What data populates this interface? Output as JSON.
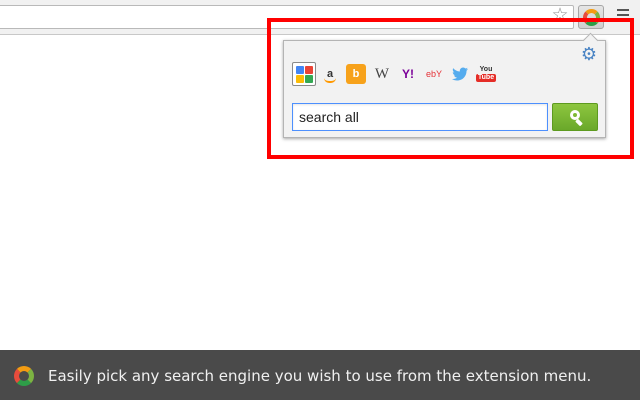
{
  "toolbar": {
    "star_icon": "star-outline-icon",
    "extension_icon": "multi-search-ring-icon",
    "menu_icon": "hamburger-menu-icon"
  },
  "popup": {
    "settings_icon": "gear-icon",
    "engines": [
      {
        "name": "google",
        "label": "",
        "selected": true
      },
      {
        "name": "amazon",
        "label": "a",
        "selected": false
      },
      {
        "name": "bing",
        "label": "b",
        "selected": false
      },
      {
        "name": "wikipedia",
        "label": "W",
        "selected": false
      },
      {
        "name": "yahoo",
        "label": "Y!",
        "selected": false
      },
      {
        "name": "ebay",
        "label": "ebY",
        "selected": false
      },
      {
        "name": "twitter",
        "label": "",
        "selected": false
      },
      {
        "name": "youtube",
        "label": "You Tube",
        "selected": false
      }
    ],
    "search_value": "search all",
    "search_button_icon": "magnifier-icon"
  },
  "caption": {
    "text": "Easily pick any search engine you wish to use from the extension menu."
  },
  "colors": {
    "highlight": "#ff0000",
    "search_button": "#7ab733",
    "caption_bg": "#4a4a4a"
  }
}
